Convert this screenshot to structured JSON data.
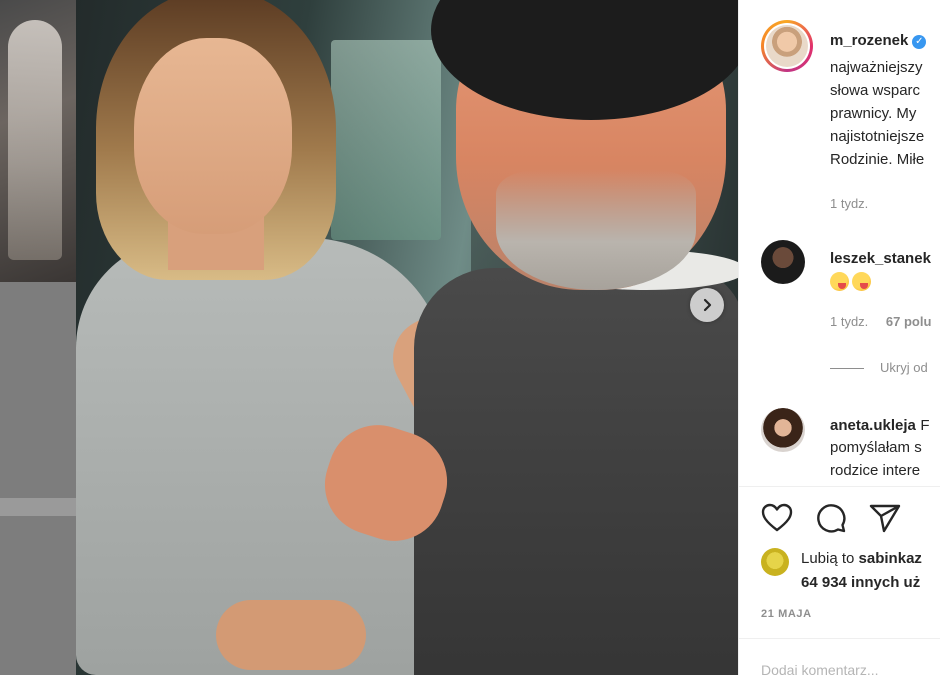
{
  "post": {
    "author": "m_rozenek",
    "caption_lines": [
      "najważniejszy",
      "słowa wsparc",
      "prawnicy. My",
      "najistotniejsze",
      "Rodzinie. Miłe"
    ],
    "time": "1 tydz."
  },
  "comments": [
    {
      "author": "leszek_stanek",
      "time": "1 tydz.",
      "likes": "67 polu",
      "hide_replies": "Ukryj od"
    },
    {
      "author": "aneta.ukleja",
      "text_first": "F",
      "lines": [
        "pomyślałam s",
        "rodzice intere"
      ]
    }
  ],
  "likes": {
    "prefix": "Lubią to ",
    "user": "sabinkaz",
    "count_text": "64 934 innych uż"
  },
  "date": "21 MAJA",
  "add_comment_placeholder": "Dodaj komentarz...",
  "icons": {
    "next": "chevron-right-icon",
    "like": "heart-icon",
    "comment": "comment-icon",
    "share": "paper-plane-icon",
    "verified": "verified-badge-icon"
  },
  "colors": {
    "verified_blue": "#3897f0",
    "meta_gray": "#8e8e8e",
    "text": "#262626"
  }
}
